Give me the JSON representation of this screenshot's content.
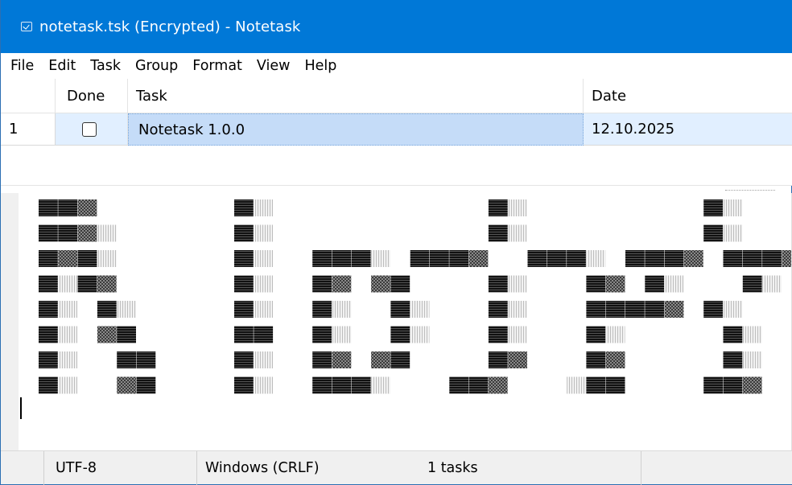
{
  "window": {
    "title": "notetask.tsk (Encrypted) - Notetask",
    "icon": "checkbox-app-icon",
    "accent": "#0078d7"
  },
  "menu": {
    "items": [
      "File",
      "Edit",
      "Task",
      "Group",
      "Format",
      "View",
      "Help"
    ]
  },
  "table": {
    "columns": [
      "Done",
      "Task",
      "Date"
    ],
    "rows": [
      {
        "num": "1",
        "done": false,
        "task": "Notetask 1.0.0",
        "date": "12.10.2025"
      }
    ],
    "selection_color": "#c5dcf8"
  },
  "editor": {
    "content_description_word": "Notetask",
    "caret_visible": true
  },
  "status": {
    "encoding": "UTF-8",
    "line_ending": "Windows (CRLF)",
    "count": "1 tasks"
  }
}
